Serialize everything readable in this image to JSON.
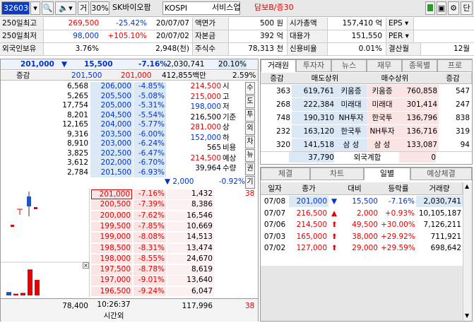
{
  "toolbar": {
    "code": "326030",
    "name": "SK바이오팜",
    "market": "KOSPI",
    "sector": "서비스업",
    "margin": "담보B/증30",
    "geo": "거",
    "pct": "30%",
    "ebtn": "EPS",
    "perbtn": "PER",
    "dan": "단"
  },
  "info": {
    "row1": {
      "l1": "250일최고",
      "v1": "269,500",
      "p1": "-25.42%",
      "d1": "20/07/07",
      "l2": "액면가",
      "v2": "500 원",
      "l3": "시가총액",
      "v3": "157,410 억",
      "l4": "EPS"
    },
    "row2": {
      "l1": "250일최저",
      "v1": "98,000",
      "p1": "+105.10%",
      "d1": "20/07/02",
      "l2": "자본금",
      "v2": "392 억",
      "l3": "대용가",
      "v3": "151,550",
      "l4": "PER"
    },
    "row3": {
      "l1": "외국인보유",
      "v1": "3.76%",
      "v1b": "2,948(천)",
      "l2": "주식수",
      "v2": "78,313 천",
      "l3": "신용비율",
      "v3": "0.01%",
      "l4": "결산월",
      "v4": "12월"
    }
  },
  "quote": {
    "price": "201,000",
    "arrow": "▼",
    "change": "15,500",
    "rate": "-7.16%",
    "volume": "2,030,741",
    "vrate": "20.10%"
  },
  "sub": {
    "label": "증감",
    "v1": "201,500",
    "v2": "201,000",
    "amount": "412,855백만",
    "rate": "2.59%"
  },
  "asks": [
    {
      "q": "6,568",
      "p": "206,000",
      "r": "-4.85%"
    },
    {
      "q": "5,265",
      "p": "205,500",
      "r": "-5.08%"
    },
    {
      "q": "17,754",
      "p": "205,000",
      "r": "-5.31%"
    },
    {
      "q": "8,201",
      "p": "204,500",
      "r": "-5.54%"
    },
    {
      "q": "12,165",
      "p": "204,000",
      "r": "-5.77%"
    },
    {
      "q": "9,316",
      "p": "203,500",
      "r": "-6.00%"
    },
    {
      "q": "8,910",
      "p": "203,000",
      "r": "-6.24%"
    },
    {
      "q": "3,825",
      "p": "202,500",
      "r": "-6.47%"
    },
    {
      "q": "3,612",
      "p": "202,000",
      "r": "-6.70%"
    },
    {
      "q": "2,784",
      "p": "201,500",
      "r": "-6.93%"
    }
  ],
  "stats": [
    {
      "v": "214,500",
      "k": "시",
      "cls": "red"
    },
    {
      "v": "215,000",
      "k": "고",
      "cls": "red"
    },
    {
      "v": "198,000",
      "k": "저",
      "cls": "blue"
    },
    {
      "v": "216,500",
      "k": "기준",
      "cls": ""
    },
    {
      "v": "281,000",
      "k": "상",
      "cls": "red"
    },
    {
      "v": "152,000",
      "k": "하",
      "cls": "blue"
    },
    {
      "v": "565",
      "k": "비용",
      "cls": ""
    },
    {
      "v": "214,500",
      "k": "예상",
      "cls": "red"
    },
    {
      "v": "39,964",
      "k": "수량",
      "cls": ""
    }
  ],
  "expected": {
    "arrow": "▼",
    "chg": "2,000",
    "rate": "-0.92%"
  },
  "sidebtns": [
    "수",
    "도",
    "투",
    "외",
    "차",
    "뉴",
    "권",
    "기"
  ],
  "bids": [
    {
      "p": "201,000",
      "r": "-7.16%",
      "q": "1,432"
    },
    {
      "p": "200,500",
      "r": "-7.39%",
      "q": "8,386"
    },
    {
      "p": "200,000",
      "r": "-7.62%",
      "q": "16,546"
    },
    {
      "p": "199,500",
      "r": "-7.85%",
      "q": "10,669"
    },
    {
      "p": "199,000",
      "r": "-8.08%",
      "q": "14,513"
    },
    {
      "p": "198,500",
      "r": "-8.31%",
      "q": "13,474"
    },
    {
      "p": "198,000",
      "r": "-8.55%",
      "q": "24,670"
    },
    {
      "p": "197,500",
      "r": "-8.78%",
      "q": "8,619"
    },
    {
      "p": "197,000",
      "r": "-9.01%",
      "q": "13,640"
    },
    {
      "p": "196,500",
      "r": "-9.24%",
      "q": "6,047"
    }
  ],
  "tick": "38",
  "bottom": {
    "askTotal": "78,400",
    "time": "10:26:37",
    "timeLabel": "시간외",
    "bidTotal": "117,996",
    "tick": "38"
  },
  "broker": {
    "tabs": [
      "거래원",
      "투자자",
      "뉴스",
      "재무",
      "종목별",
      "프로"
    ],
    "headers": {
      "inc": "증감",
      "sell": "매도상위",
      "buy": "매수상위",
      "inc2": "증감"
    },
    "rows": [
      {
        "si": "363",
        "sq": "619,761",
        "sn": "키움증",
        "bn": "키움증",
        "bq": "760,858",
        "bi": "547"
      },
      {
        "si": "268",
        "sq": "222,384",
        "sn": "미래대",
        "bn": "미래대",
        "bq": "301,414",
        "bi": "247"
      },
      {
        "si": "748",
        "sq": "190,310",
        "sn": "NH투자",
        "bn": "한국투",
        "bq": "136,796",
        "bi": "838"
      },
      {
        "si": "232",
        "sq": "163,120",
        "sn": "한국투",
        "bn": "NH투자",
        "bq": "136,716",
        "bi": "319"
      },
      {
        "si": "320",
        "sq": "141,518",
        "sn": "삼 성",
        "bn": "삼 성",
        "bq": "133,087",
        "bi": "94"
      }
    ],
    "foreign": {
      "sq": "37,790",
      "label": "외국계합",
      "bq": "0"
    }
  },
  "daily": {
    "tabs": [
      "체결",
      "차트",
      "일별",
      "예상체결"
    ],
    "headers": [
      "일자",
      "종가",
      "대비",
      "등락률",
      "거래량"
    ],
    "rows": [
      {
        "d": "07/08",
        "c": "201,000",
        "a": "▼",
        "ch": "15,500",
        "r": "-7.16%",
        "v": "2,030,741",
        "cls": "blue"
      },
      {
        "d": "07/07",
        "c": "216,500",
        "a": "▲",
        "ch": "2,000",
        "r": "+0.93%",
        "v": "10,105,187",
        "cls": "red"
      },
      {
        "d": "07/06",
        "c": "214,500",
        "a": "⬆",
        "ch": "49,500",
        "r": "+30.00%",
        "v": "7,126,211",
        "cls": "red"
      },
      {
        "d": "07/03",
        "c": "165,000",
        "a": "⬆",
        "ch": "38,000",
        "r": "+29.92%",
        "v": "711,921",
        "cls": "red"
      },
      {
        "d": "07/02",
        "c": "127,000",
        "a": "⬆",
        "ch": "29,000",
        "r": "+29.59%",
        "v": "698,642",
        "cls": "red"
      }
    ]
  },
  "colors": {
    "accent": "#0033cc",
    "up": "#e60000",
    "ask_bg": "#dbe9f7",
    "bid_bg": "#fbe4e4",
    "bar": "#e60000"
  },
  "mini_bars": [
    0.12,
    0.06,
    0.09,
    0.92,
    0.55
  ]
}
